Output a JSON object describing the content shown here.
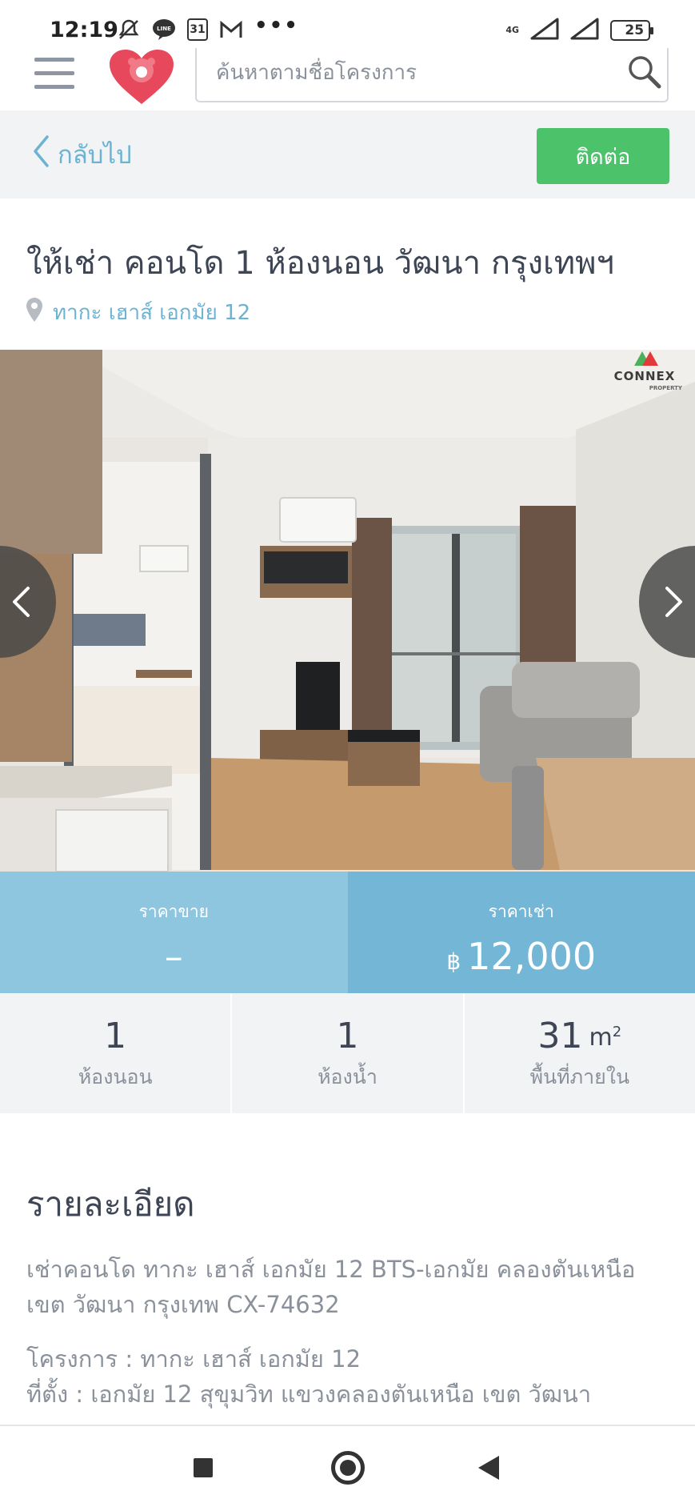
{
  "status_bar": {
    "time": "12:19",
    "calendar_day": "31",
    "network": "4G",
    "battery": "25",
    "battery_level": 0.25
  },
  "header": {
    "search_placeholder": "ค้นหาตามชื่อโครงการ",
    "brand_color": "#e8485b"
  },
  "subheader": {
    "back_label": "กลับไป",
    "contact_label": "ติดต่อ",
    "contact_color": "#4cc36b"
  },
  "listing": {
    "title": "ให้เช่า คอนโด 1 ห้องนอน วัฒนา กรุงเทพฯ",
    "location": "ทากะ เฮาส์ เอกมัย 12",
    "photo_watermark": "CONNEX",
    "photo_watermark_sub": "PROPERTY"
  },
  "prices": {
    "sale_label": "ราคาขาย",
    "sale_value": "–",
    "rent_label": "ราคาเช่า",
    "rent_currency": "฿",
    "rent_value": "12,000"
  },
  "specs": [
    {
      "value": "1",
      "unit": "",
      "label": "ห้องนอน"
    },
    {
      "value": "1",
      "unit": "",
      "label": "ห้องน้ำ"
    },
    {
      "value": "31",
      "unit": "m",
      "unit_sup": "2",
      "label": "พื้นที่ภายใน"
    }
  ],
  "details": {
    "heading": "รายละเอียด",
    "description_line1": "เช่าคอนโด ทากะ เฮาส์ เอกมัย 12 BTS-เอกมัย คลองตันเหนือ",
    "description_line2": "เขต วัฒนา กรุงเทพ CX-74632",
    "project_line": "โครงการ : ทากะ เฮาส์ เอกมัย 12",
    "address_line": "ที่ตั้ง : เอกมัย 12 สุขุมวิท แขวงคลองตันเหนือ เขต วัฒนา"
  }
}
